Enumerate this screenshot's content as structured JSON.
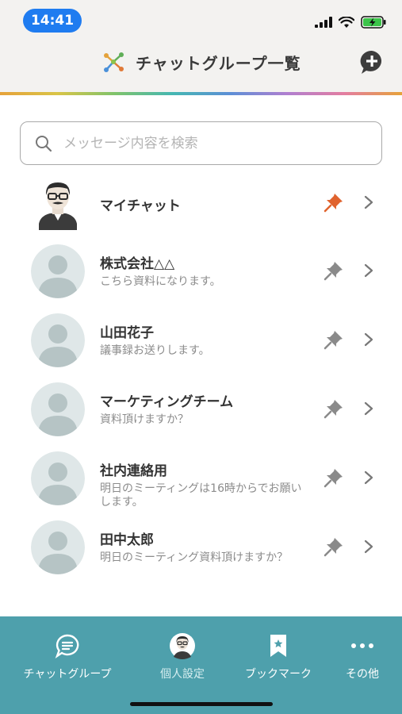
{
  "status": {
    "time": "14:41"
  },
  "header": {
    "title": "チャットグループ一覧",
    "new_chat_icon": "chat-plus-icon"
  },
  "search": {
    "placeholder": "メッセージ内容を検索",
    "value": ""
  },
  "chats": [
    {
      "name": "マイチャット",
      "preview": "",
      "pinned": true,
      "avatar": "man-glasses-avatar"
    },
    {
      "name": "株式会社△△",
      "preview": "こちら資料になります。",
      "pinned": false,
      "avatar": "default-avatar"
    },
    {
      "name": "山田花子",
      "preview": "議事録お送りします。",
      "pinned": false,
      "avatar": "default-avatar"
    },
    {
      "name": "マーケティングチーム",
      "preview": "資料頂けますか？",
      "pinned": false,
      "avatar": "default-avatar"
    },
    {
      "name": "社内連絡用",
      "preview": "明日のミーティングは16時からでお願いします。",
      "pinned": false,
      "avatar": "default-avatar"
    },
    {
      "name": "田中太郎",
      "preview": "明日のミーティング資料頂けますか？",
      "pinned": false,
      "avatar": "default-avatar"
    }
  ],
  "tabs": [
    {
      "label": "チャットグループ",
      "icon": "chat-bubble-icon",
      "active": false
    },
    {
      "label": "個人設定",
      "icon": "profile-avatar-icon",
      "active": true
    },
    {
      "label": "ブックマーク",
      "icon": "bookmark-icon",
      "active": false
    },
    {
      "label": "その他",
      "icon": "more-icon",
      "active": false
    }
  ],
  "colors": {
    "time_pill": "#1f7cf0",
    "tabbar": "#4ea0ac",
    "pin_active": "#e0632e",
    "pin_inactive": "#8a8a8a",
    "header_bg": "#f3f2f0"
  }
}
